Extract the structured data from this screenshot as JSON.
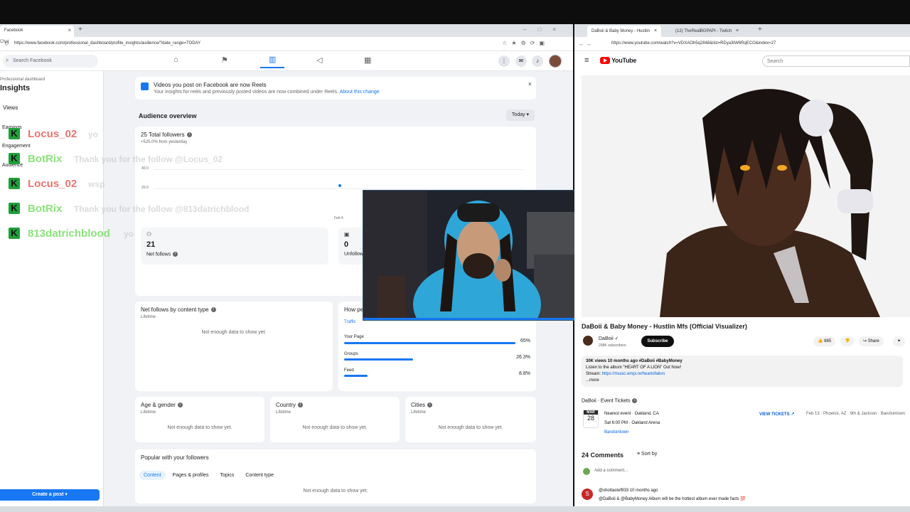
{
  "left_window": {
    "tab_title": "Facebook",
    "url": "https://www.facebook.com/professional_dashboard/profile_insights/audience/?date_range=TODAY",
    "chat_ext_label": "Chat",
    "search_placeholder": "Search Facebook"
  },
  "sidebar": {
    "breadcrumb": "Professional dashboard",
    "title": "Insights",
    "items": {
      "views": "Views",
      "earnings": "Earnings",
      "engagement": "Engagement",
      "audience": "Audience"
    },
    "create_post": "Create a post"
  },
  "banner": {
    "title": "Videos you post on Facebook are now Reels",
    "text": "Your insights for reels and previously posted videos are now combined under Reels.",
    "link": "About this change"
  },
  "audience": {
    "title": "Audience overview",
    "range": "Today",
    "total_followers": "25 Total followers",
    "change": "+525.0% from yesterday",
    "ticks": [
      "40.0",
      "20.0"
    ],
    "date_label": "Feb 4",
    "net_follows_value": "21",
    "net_follows_label": "Net follows",
    "unfollows_value": "0",
    "unfollows_label": "Unfollows"
  },
  "content_type": {
    "title": "Net follows by content type",
    "sub": "Lifetime",
    "empty": "Not enough data to show yet."
  },
  "traffic": {
    "title": "How people...",
    "tab": "Traffic",
    "rows": [
      {
        "label": "Your Page",
        "pct": "65%",
        "fill": 0.65
      },
      {
        "label": "Groups",
        "pct": "26.3%",
        "fill": 0.263
      },
      {
        "label": "Feed",
        "pct": "8.8%",
        "fill": 0.088
      }
    ]
  },
  "age_gender": {
    "title": "Age & gender",
    "sub": "Lifetime",
    "empty": "Not enough data to show yet."
  },
  "country": {
    "title": "Country",
    "sub": "Lifetime",
    "empty": "Not enough data to show yet."
  },
  "cities": {
    "title": "Cities",
    "sub": "Lifetime",
    "empty": "Not enough data to show yet."
  },
  "popular": {
    "title": "Popular with your followers",
    "tabs": [
      "Content",
      "Pages & profiles",
      "Topics",
      "Content type"
    ],
    "empty": "Not enough data to show yet."
  },
  "chat": [
    {
      "name": "Locus_02",
      "color": "#e8756f",
      "msg": "yo"
    },
    {
      "name": "BotRix",
      "color": "#8be27b",
      "msg": "Thank you for the follow @Locus_02"
    },
    {
      "name": "Locus_02",
      "color": "#e8756f",
      "msg": "wsp"
    },
    {
      "name": "BotRix",
      "color": "#8be27b",
      "msg": "Thank you for the follow @813datrichblood"
    },
    {
      "name": "813datrichblood",
      "color": "#8be27b",
      "msg": "yo"
    }
  ],
  "right_window": {
    "tab1": "DaBoii & Baby Money - Hustlin",
    "tab2": "(12) TheRealBGPAPI - Twitch",
    "url": "https://www.youtube.com/watch?v=VDXAOh5q2848&list=RDya3tW6RqECO&index=27",
    "logo_text": "YouTube",
    "search_placeholder": "Search"
  },
  "video": {
    "title": "DaBoii & Baby Money - Hustlin Mfs (Official Visualizer)",
    "channel": "DaBoii",
    "subs": "208K subscribers",
    "subscribe": "Subscribe",
    "likes": "885",
    "share": "Share",
    "desc_meta": "30K views  10 months ago  #DaBoii #BabyMoney",
    "desc_line1": "Listen to the album \"HEART OF A LION\" Out Now!",
    "desc_stream": "Stream:",
    "desc_link": "https://music.empi.re/heartofalion",
    "desc_more": "...more"
  },
  "events": {
    "title": "DaBoii · Event Tickets",
    "month": "MAR",
    "day": "28",
    "line1": "Nearest event · Oakland, CA",
    "line2": "Sat 6:00 PM · Oakland Arena",
    "line3": "Bandsintown",
    "tickets": "VIEW TICKETS",
    "next": "Feb 13 · Phoenix, AZ · 9th & Jackson · Bandsintown"
  },
  "comments": {
    "count": "24 Comments",
    "sort": "Sort by",
    "add": "Add a comment...",
    "author": "@shottastef933  10 months ago",
    "avatar": "S",
    "text": "@DaBoii & @BabyMoney Album will be the hottest album ever made facts 💯"
  }
}
